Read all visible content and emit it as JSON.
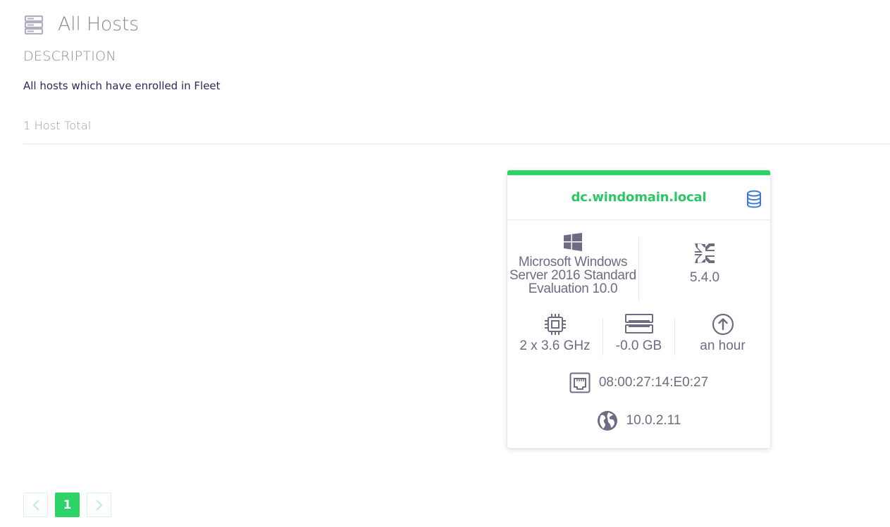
{
  "header": {
    "title": "All Hosts",
    "icon": "server-stack-icon"
  },
  "description": {
    "label": "DESCRIPTION",
    "text": "All hosts which have enrolled in Fleet"
  },
  "host_total": "1 Host Total",
  "host_card": {
    "status_color": "#2cd468",
    "hostname": "dc.windomain.local",
    "os_lines": [
      "Microsoft Windows",
      "Server 2016 Standard",
      "Evaluation 10.0"
    ],
    "osquery_version": "5.4.0",
    "cpu": "2 x 3.6 GHz",
    "memory": "-0.0 GB",
    "uptime": "an hour",
    "mac": "08:00:27:14:E0:27",
    "ip": "10.0.2.11"
  },
  "pagination": {
    "current_page": "1"
  },
  "colors": {
    "accent": "#2cd468",
    "hostname": "#2cc665",
    "db_icon": "#3a78d8"
  }
}
